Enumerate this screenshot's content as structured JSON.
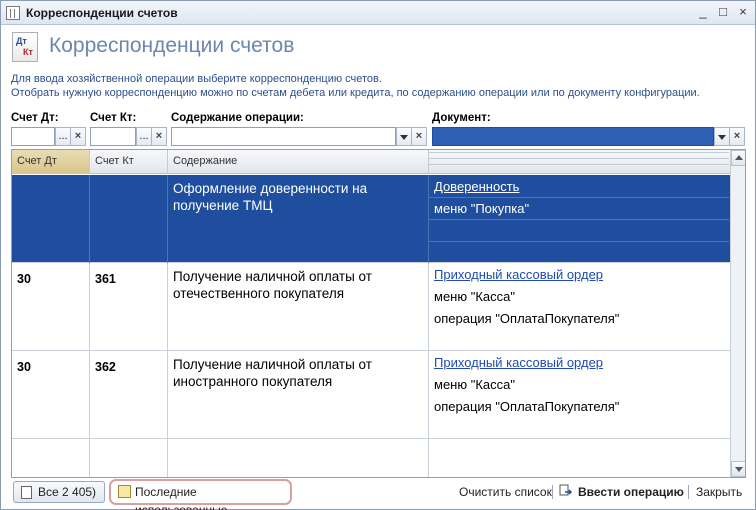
{
  "window": {
    "title": "Корреспонденции счетов",
    "controls": [
      "_",
      "□",
      "×"
    ]
  },
  "header": {
    "icon_text_top": "Дт",
    "icon_text_bottom": "Кт",
    "title": "Корреспонденции счетов",
    "hint_line1": "Для ввода хозяйственной операции выберите корреспонденцию счетов.",
    "hint_line2": "Отобрать нужную корреспонденцию можно по счетам дебета или кредита, по содержанию операции или по документу конфигурации."
  },
  "filters": {
    "debit_label": "Счет Дт:",
    "credit_label": "Счет Кт:",
    "content_label": "Содержание операции:",
    "document_label": "Документ:",
    "debit_value": "",
    "credit_value": "",
    "content_value": "",
    "document_value": "",
    "select_button": "...",
    "clear_button": "×"
  },
  "grid": {
    "columns": [
      "Счет Дт",
      "Счет Кт",
      "Содержание"
    ],
    "rows": [
      {
        "debit": "",
        "credit": "",
        "content": "Оформление доверенности на получение ТМЦ",
        "doc_link": "Доверенность",
        "doc_lines": [
          "меню \"Покупка\""
        ]
      },
      {
        "debit": "30",
        "credit": "361",
        "content": "Получение наличной оплаты от отечественного покупателя",
        "doc_link": "Приходный кассовый ордер",
        "doc_lines": [
          "меню \"Касса\"",
          "операция \"ОплатаПокупателя\""
        ]
      },
      {
        "debit": "30",
        "credit": "362",
        "content": "Получение наличной оплаты от иностранного покупателя",
        "doc_link": "Приходный кассовый ордер",
        "doc_lines": [
          "меню \"Касса\"",
          "операция \"ОплатаПокупателя\""
        ]
      }
    ]
  },
  "bottom": {
    "tab_all": "Все 2 405)",
    "tab_recent": "Последние использованные",
    "clear_list": "Очистить список",
    "enter_operation": "Ввести операцию",
    "close": "Закрыть"
  },
  "colors": {
    "selection": "#1f4e9e",
    "title": "#6d86ad",
    "hint": "#2c4f8c",
    "link": "#1f4bb3",
    "active_header": "#d9c58b"
  }
}
